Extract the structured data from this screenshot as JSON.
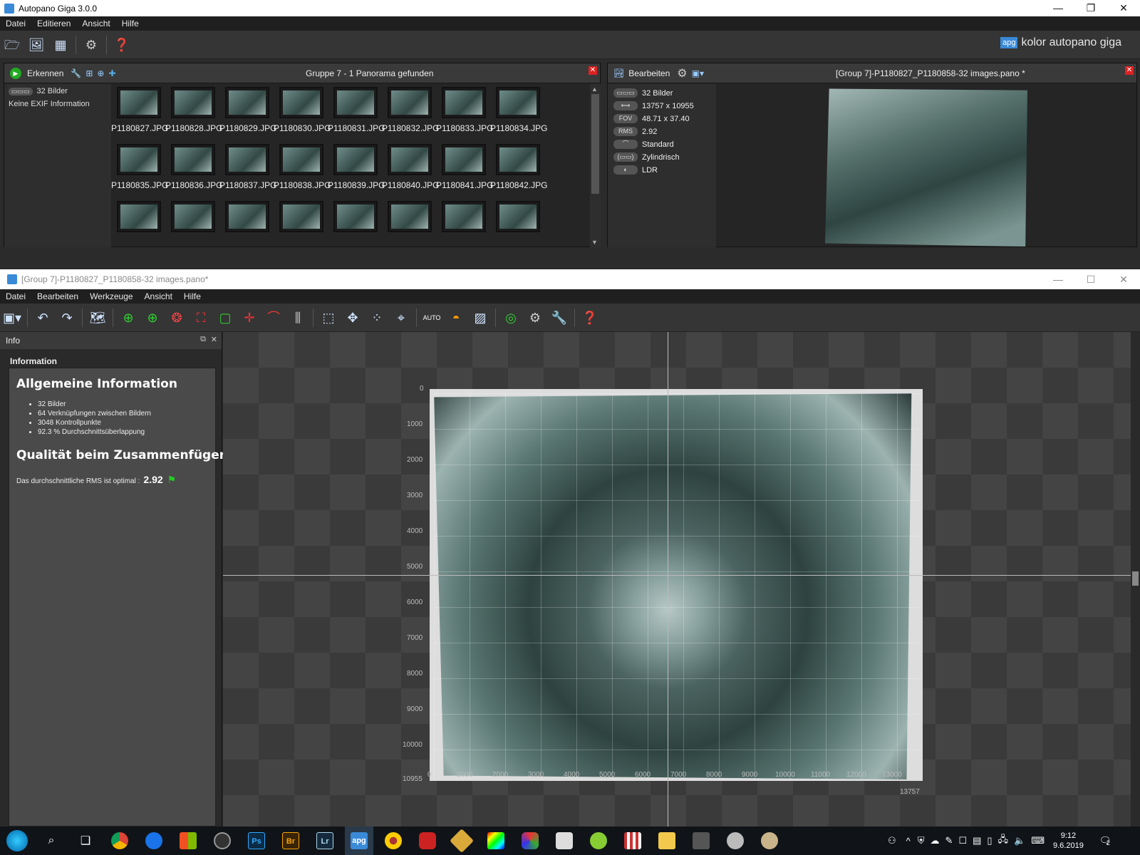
{
  "top_window": {
    "title": "Autopano Giga 3.0.0",
    "menu": [
      "Datei",
      "Editieren",
      "Ansicht",
      "Hilfe"
    ],
    "brand": "kolor autopano giga",
    "brand_badge": "apg"
  },
  "group_panel": {
    "detect_label": "Erkennen",
    "title": "Gruppe 7 - 1 Panorama gefunden",
    "image_count": "32 Bilder",
    "exif": "Keine EXIF Information",
    "thumbnails": [
      "P1180827.JPG",
      "P1180828.JPG",
      "P1180829.JPG",
      "P1180830.JPG",
      "P1180831.JPG",
      "P1180832.JPG",
      "P1180833.JPG",
      "P1180834.JPG",
      "P1180835.JPG",
      "P1180836.JPG",
      "P1180837.JPG",
      "P1180838.JPG",
      "P1180839.JPG",
      "P1180840.JPG",
      "P1180841.JPG",
      "P1180842.JPG",
      "",
      "",
      "",
      "",
      "",
      "",
      "",
      ""
    ]
  },
  "pano_panel": {
    "edit_label": "Bearbeiten",
    "title": "[Group 7]-P1180827_P1180858-32 images.pano *",
    "props": [
      {
        "icon": "images-icon",
        "tag": "▭▭▭",
        "value": "32 Bilder"
      },
      {
        "icon": "size-icon",
        "tag": "⟷",
        "value": "13757 x 10955"
      },
      {
        "icon": "fov-icon",
        "tag": "FOV",
        "value": "48.71 x 37.40"
      },
      {
        "icon": "rms-icon",
        "tag": "RMS",
        "value": "2.92"
      },
      {
        "icon": "standard-icon",
        "tag": "⌒",
        "value": "Standard"
      },
      {
        "icon": "projection-icon",
        "tag": "(▭▭)",
        "value": "Zylindrisch"
      },
      {
        "icon": "ldr-icon",
        "tag": "◐",
        "value": "LDR"
      }
    ]
  },
  "editor_window": {
    "title": "[Group 7]-P1180827_P1180858-32 images.pano*",
    "menu": [
      "Datei",
      "Bearbeiten",
      "Werkzeuge",
      "Ansicht",
      "Hilfe"
    ]
  },
  "info_panel": {
    "tab": "Info",
    "section": "Information",
    "general_heading": "Allgemeine Information",
    "bullets": [
      "32 Bilder",
      "64 Verknüpfungen zwischen Bildern",
      "3048 Kontrollpunkte",
      "92.3 % Durchschnittsüberlappung"
    ],
    "quality_heading": "Qualität beim Zusammenfügen",
    "rms_text": "Das durchschnittliche RMS ist optimal :",
    "rms_value": "2.92"
  },
  "canvas": {
    "y_ticks": [
      "0",
      "1000",
      "2000",
      "3000",
      "4000",
      "5000",
      "6000",
      "7000",
      "8000",
      "9000",
      "10000",
      "10955"
    ],
    "x_ticks": [
      "0",
      "1000",
      "2000",
      "3000",
      "4000",
      "5000",
      "6000",
      "7000",
      "8000",
      "9000",
      "10000",
      "11000",
      "12000",
      "13000"
    ],
    "x_end": "13757"
  },
  "taskbar": {
    "time": "9:12",
    "date": "9.6.2019",
    "notif_count": "2",
    "apps": [
      {
        "name": "ps",
        "label": "Ps",
        "color": "#0b2b44"
      },
      {
        "name": "br",
        "label": "Br",
        "color": "#3a2408"
      },
      {
        "name": "lr",
        "label": "Lr",
        "color": "#152a3d"
      },
      {
        "name": "apg",
        "label": "apg",
        "color": "#3a8ad8"
      }
    ]
  }
}
